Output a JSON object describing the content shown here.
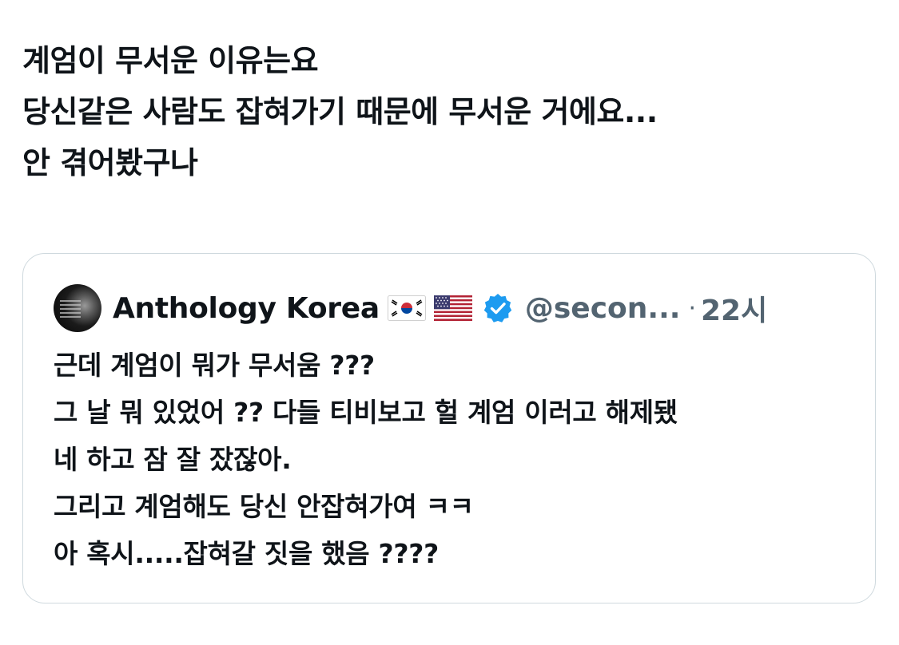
{
  "post": {
    "lines": [
      "계엄이 무서운 이유는요",
      "당신같은 사람도 잡혀가기 때문에 무서운 거에요...",
      "안 겪어봤구나"
    ]
  },
  "quoted_post": {
    "display_name": "Anthology Korea",
    "flags": [
      "south-korea-flag",
      "us-flag"
    ],
    "verified_icon": "verified-badge-icon",
    "handle": "@secon...",
    "separator": "·",
    "timestamp": "22시",
    "lines": [
      "근데 계엄이 뭐가 무서움 ???",
      "그 날 뭐 있었어 ?? 다들 티비보고 헐 계엄 이러고 해제됐",
      "네 하고 잠 잘 잤잖아.",
      "그리고 계엄해도 당신 안잡혀가여 ㅋㅋ",
      "아 혹시.....잡혀갈 짓을 했음 ????"
    ]
  },
  "colors": {
    "text_primary": "#0f1419",
    "text_secondary": "#536471",
    "card_border": "#cfd9de",
    "verified_blue": "#1d9bf0"
  }
}
